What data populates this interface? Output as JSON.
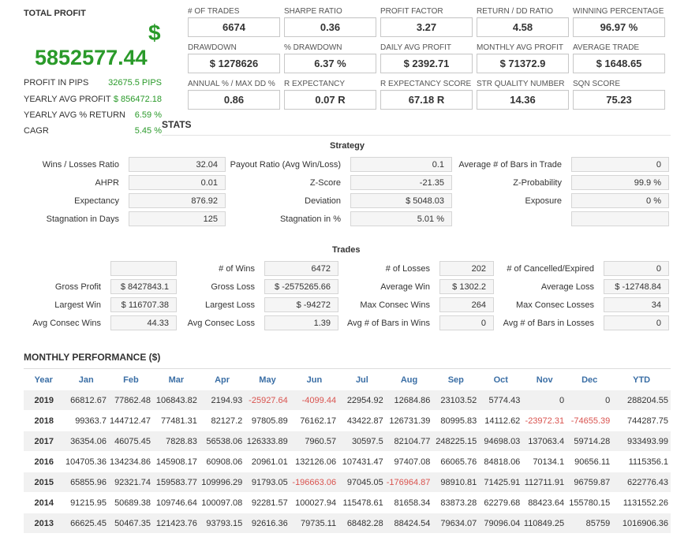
{
  "total_profit": {
    "label": "TOTAL PROFIT",
    "currency": "$",
    "value": "5852577.44",
    "color": "#2a9a2a",
    "rows": [
      {
        "label": "PROFIT IN PIPS",
        "value": "32675.5 PIPS"
      },
      {
        "label": "YEARLY AVG PROFIT",
        "value": "$ 856472.18"
      },
      {
        "label": "YEARLY AVG % RETURN",
        "value": "6.59 %"
      },
      {
        "label": "CAGR",
        "value": "5.45 %"
      }
    ]
  },
  "metrics": [
    {
      "label": "# OF TRADES",
      "value": "6674"
    },
    {
      "label": "SHARPE RATIO",
      "value": "0.36"
    },
    {
      "label": "PROFIT FACTOR",
      "value": "3.27"
    },
    {
      "label": "RETURN / DD RATIO",
      "value": "4.58"
    },
    {
      "label": "WINNING PERCENTAGE",
      "value": "96.97 %"
    },
    {
      "label": "DRAWDOWN",
      "value": "$ 1278626"
    },
    {
      "label": "% DRAWDOWN",
      "value": "6.37 %"
    },
    {
      "label": "DAILY AVG PROFIT",
      "value": "$ 2392.71"
    },
    {
      "label": "MONTHLY AVG PROFIT",
      "value": "$ 71372.9"
    },
    {
      "label": "AVERAGE TRADE",
      "value": "$ 1648.65"
    },
    {
      "label": "ANNUAL % / MAX DD %",
      "value": "0.86"
    },
    {
      "label": "R EXPECTANCY",
      "value": "0.07 R"
    },
    {
      "label": "R EXPECTANCY SCORE",
      "value": "67.18 R"
    },
    {
      "label": "STR QUALITY NUMBER",
      "value": "14.36"
    },
    {
      "label": "SQN SCORE",
      "value": "75.23"
    }
  ],
  "stats": {
    "title": "STATS",
    "strategy": {
      "title": "Strategy",
      "fields": [
        {
          "label": "Wins / Losses Ratio",
          "value": "32.04"
        },
        {
          "label": "Payout Ratio (Avg Win/Loss)",
          "value": "0.1"
        },
        {
          "label": "Average # of Bars in Trade",
          "value": "0"
        },
        {
          "label": "AHPR",
          "value": "0.01"
        },
        {
          "label": "Z-Score",
          "value": "-21.35"
        },
        {
          "label": "Z-Probability",
          "value": "99.9 %"
        },
        {
          "label": "Expectancy",
          "value": "876.92"
        },
        {
          "label": "Deviation",
          "value": "$ 5048.03"
        },
        {
          "label": "Exposure",
          "value": "0 %"
        },
        {
          "label": "Stagnation in Days",
          "value": "125"
        },
        {
          "label": "Stagnation in %",
          "value": "5.01 %"
        },
        {
          "label": "",
          "value": ""
        }
      ]
    },
    "trades": {
      "title": "Trades",
      "fields": [
        {
          "label": "",
          "value": ""
        },
        {
          "label": "# of Wins",
          "value": "6472"
        },
        {
          "label": "# of Losses",
          "value": "202"
        },
        {
          "label": "# of Cancelled/Expired",
          "value": "0"
        },
        {
          "label": "Gross Profit",
          "value": "$ 8427843.1"
        },
        {
          "label": "Gross Loss",
          "value": "$ -2575265.66"
        },
        {
          "label": "Average Win",
          "value": "$ 1302.2"
        },
        {
          "label": "Average Loss",
          "value": "$ -12748.84"
        },
        {
          "label": "Largest Win",
          "value": "$ 116707.38"
        },
        {
          "label": "Largest Loss",
          "value": "$ -94272"
        },
        {
          "label": "Max Consec Wins",
          "value": "264"
        },
        {
          "label": "Max Consec Losses",
          "value": "34"
        },
        {
          "label": "Avg Consec Wins",
          "value": "44.33"
        },
        {
          "label": "Avg Consec Loss",
          "value": "1.39"
        },
        {
          "label": "Avg # of Bars in Wins",
          "value": "0"
        },
        {
          "label": "Avg # of Bars in Losses",
          "value": "0"
        }
      ]
    }
  },
  "monthly": {
    "title": "MONTHLY PERFORMANCE ($)",
    "negative_color": "#d9534f",
    "header_color": "#3a6ea5",
    "headers": [
      "Year",
      "Jan",
      "Feb",
      "Mar",
      "Apr",
      "May",
      "Jun",
      "Jul",
      "Aug",
      "Sep",
      "Oct",
      "Nov",
      "Dec",
      "YTD"
    ],
    "rows": [
      [
        "2019",
        "66812.67",
        "77862.48",
        "106843.82",
        "2194.93",
        "-25927.64",
        "-4099.44",
        "22954.92",
        "12684.86",
        "23103.52",
        "5774.43",
        "0",
        "0",
        "288204.55"
      ],
      [
        "2018",
        "99363.7",
        "144712.47",
        "77481.31",
        "82127.2",
        "97805.89",
        "76162.17",
        "43422.87",
        "126731.39",
        "80995.83",
        "14112.62",
        "-23972.31",
        "-74655.39",
        "744287.75"
      ],
      [
        "2017",
        "36354.06",
        "46075.45",
        "7828.83",
        "56538.06",
        "126333.89",
        "7960.57",
        "30597.5",
        "82104.77",
        "248225.15",
        "94698.03",
        "137063.4",
        "59714.28",
        "933493.99"
      ],
      [
        "2016",
        "104705.36",
        "134234.86",
        "145908.17",
        "60908.06",
        "20961.01",
        "132126.06",
        "107431.47",
        "97407.08",
        "66065.76",
        "84818.06",
        "70134.1",
        "90656.11",
        "1115356.1"
      ],
      [
        "2015",
        "65855.96",
        "92321.74",
        "159583.77",
        "109996.29",
        "91793.05",
        "-196663.06",
        "97045.05",
        "-176964.87",
        "98910.81",
        "71425.91",
        "112711.91",
        "96759.87",
        "622776.43"
      ],
      [
        "2014",
        "91215.95",
        "50689.38",
        "109746.64",
        "100097.08",
        "92281.57",
        "100027.94",
        "115478.61",
        "81658.34",
        "83873.28",
        "62279.68",
        "88423.64",
        "155780.15",
        "1131552.26"
      ],
      [
        "2013",
        "66625.45",
        "50467.35",
        "121423.76",
        "93793.15",
        "92616.36",
        "79735.11",
        "68482.28",
        "88424.54",
        "79634.07",
        "79096.04",
        "110849.25",
        "85759",
        "1016906.36"
      ]
    ]
  }
}
